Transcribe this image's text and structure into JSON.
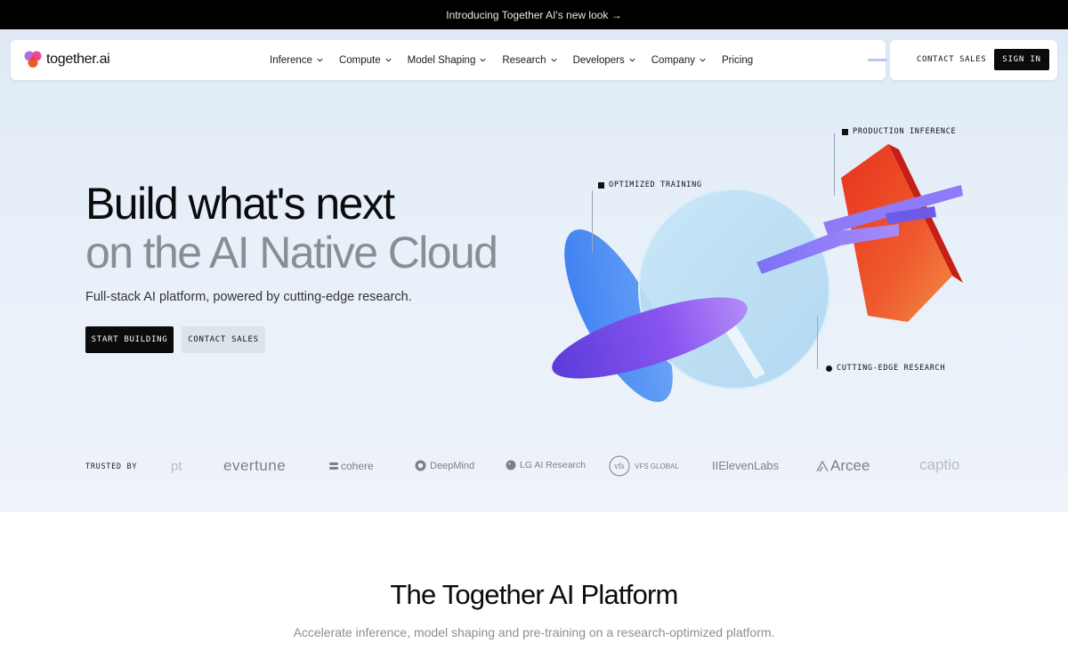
{
  "announcement": {
    "text": "Introducing Together AI's new look →"
  },
  "nav": {
    "logo_text": "together.ai",
    "items": [
      {
        "label": "Inference",
        "dropdown": true
      },
      {
        "label": "Compute",
        "dropdown": true
      },
      {
        "label": "Model Shaping",
        "dropdown": true
      },
      {
        "label": "Research",
        "dropdown": true
      },
      {
        "label": "Developers",
        "dropdown": true
      },
      {
        "label": "Company",
        "dropdown": true
      },
      {
        "label": "Pricing",
        "dropdown": false
      }
    ],
    "contact_sales": "CONTACT SALES",
    "sign_in": "SIGN IN"
  },
  "hero": {
    "headline_line1": "Build what's next",
    "headline_line2": "on the AI Native Cloud",
    "subtitle": "Full-stack AI platform, powered by cutting-edge research.",
    "cta_primary": "START BUILDING",
    "cta_secondary": "CONTACT SALES",
    "labels": {
      "optimized_training": "OPTIMIZED TRAINING",
      "production_inference": "PRODUCTION INFERENCE",
      "cutting_edge_research": "CUTTING-EDGE RESEARCH"
    }
  },
  "trusted": {
    "label": "TRUSTED BY",
    "brands": [
      "pt",
      "evertune",
      "cohere",
      "DeepMind",
      "LG AI Research",
      "VFS GLOBAL",
      "IIElevenLabs",
      "Arcee",
      "captio"
    ]
  },
  "platform": {
    "title": "The Together AI Platform",
    "subtitle": "Accelerate inference, model shaping and pre-training on a research-optimized platform."
  },
  "colors": {
    "hero_bg": "#e5eef8",
    "accent_red": "#e8321f",
    "accent_purple": "#7b5cf0",
    "accent_blue": "#3d72e8"
  }
}
